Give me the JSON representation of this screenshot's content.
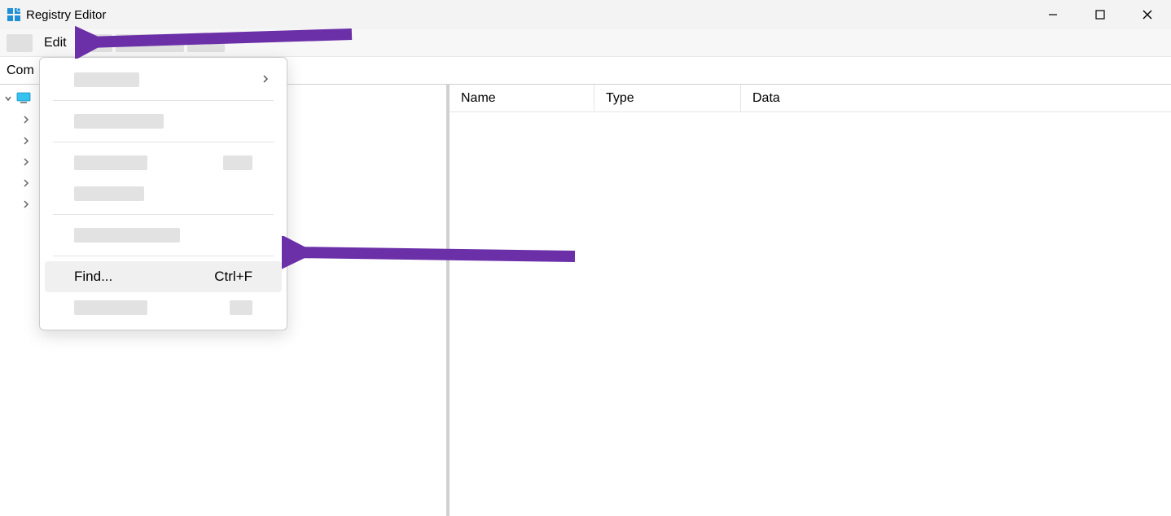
{
  "window": {
    "title": "Registry Editor"
  },
  "menubar": {
    "edit": "Edit"
  },
  "addressbar": {
    "path": "Com"
  },
  "columns": {
    "name": "Name",
    "type": "Type",
    "data": "Data"
  },
  "dropdown": {
    "find_label": "Find...",
    "find_shortcut": "Ctrl+F"
  },
  "annotation": {
    "arrow_color": "#6b2fa8"
  }
}
